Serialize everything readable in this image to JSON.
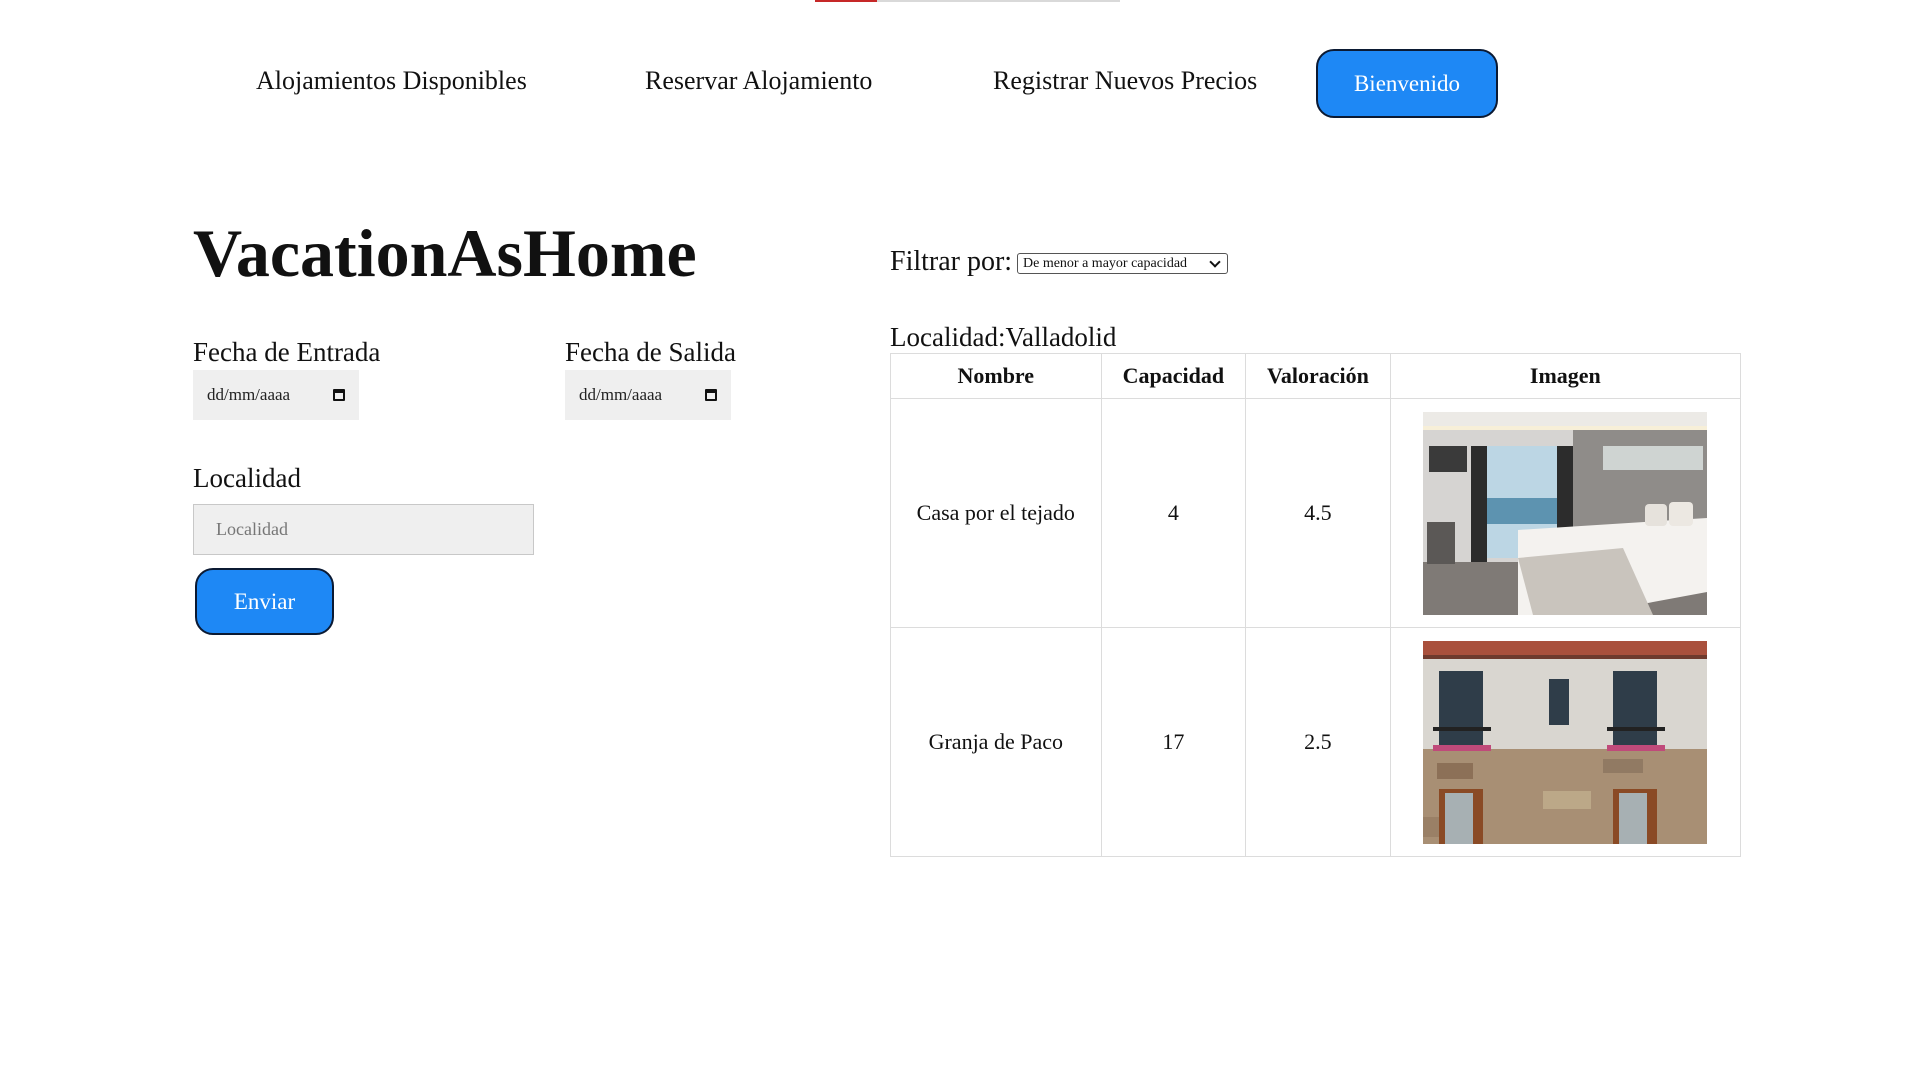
{
  "nav": {
    "links": [
      "Alojamientos Disponibles",
      "Reservar Alojamiento",
      "Registrar Nuevos Precios"
    ],
    "welcome_button": "Bienvenido"
  },
  "app_title": "VacationAsHome",
  "form": {
    "checkin_label": "Fecha de Entrada",
    "checkin_value": "dd/mm/aaaa",
    "checkout_label": "Fecha de Salida",
    "checkout_value": "dd/mm/aaaa",
    "location_label": "Localidad",
    "location_placeholder": "Localidad",
    "submit_label": "Enviar"
  },
  "filter": {
    "label": "Filtrar por:",
    "selected": "De menor a mayor capacidad"
  },
  "results": {
    "location_heading": "Localidad:Valladolid",
    "columns": [
      "Nombre",
      "Capacidad",
      "Valoración",
      "Imagen"
    ],
    "rows": [
      {
        "nombre": "Casa por el tejado",
        "capacidad": "4",
        "valoracion": "4.5",
        "image": "hotel-bedroom-photo"
      },
      {
        "nombre": "Granja de Paco",
        "capacidad": "17",
        "valoracion": "2.5",
        "image": "stone-house-facade-photo"
      }
    ]
  },
  "colors": {
    "button_blue": "#1e88f5",
    "button_border": "#0b1a33",
    "input_bg": "#efefef",
    "top_accent": "#c62828"
  }
}
